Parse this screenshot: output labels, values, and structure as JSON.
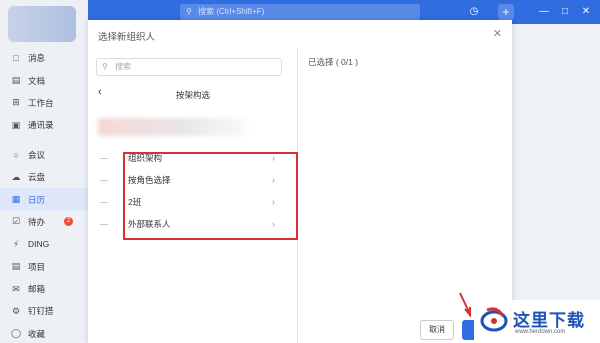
{
  "titlebar": {
    "search_placeholder": "搜索 (Ctrl+Shift+F)",
    "icons": [
      "history-icon",
      "plus-icon",
      "minimize-icon",
      "maximize-icon",
      "close-icon"
    ]
  },
  "sidebar": {
    "items": [
      {
        "label": "消息",
        "icon": "message-icon"
      },
      {
        "label": "文档",
        "icon": "document-icon"
      },
      {
        "label": "工作台",
        "icon": "workbench-icon"
      },
      {
        "label": "通讯录",
        "icon": "contacts-icon"
      },
      {
        "label": "会议",
        "icon": "meeting-icon"
      },
      {
        "label": "云盘",
        "icon": "cloud-icon"
      },
      {
        "label": "日历",
        "icon": "calendar-icon",
        "active": true
      },
      {
        "label": "待办",
        "icon": "todo-icon",
        "badge": "2"
      },
      {
        "label": "DING",
        "icon": "ding-icon"
      },
      {
        "label": "项目",
        "icon": "project-icon"
      },
      {
        "label": "邮箱",
        "icon": "mail-icon"
      },
      {
        "label": "钉钉搭",
        "icon": "builder-icon"
      },
      {
        "label": "收藏",
        "icon": "favorite-icon"
      }
    ]
  },
  "dialog": {
    "title": "选择新组织人",
    "left": {
      "search_placeholder": "搜索",
      "structure_title": "按架构选",
      "options": [
        {
          "label": "组织架构"
        },
        {
          "label": "按角色选择"
        },
        {
          "label": "2班"
        },
        {
          "label": "外部联系人"
        }
      ]
    },
    "right": {
      "selected_label": "已选择 ( 0/1 )"
    },
    "buttons": {
      "cancel": "取消"
    }
  },
  "watermark": {
    "text": "这里下载",
    "url": "www.herdown.com"
  },
  "colors": {
    "brand": "#2f6de1",
    "highlight_box": "#d63030",
    "badge": "#f0493e"
  }
}
